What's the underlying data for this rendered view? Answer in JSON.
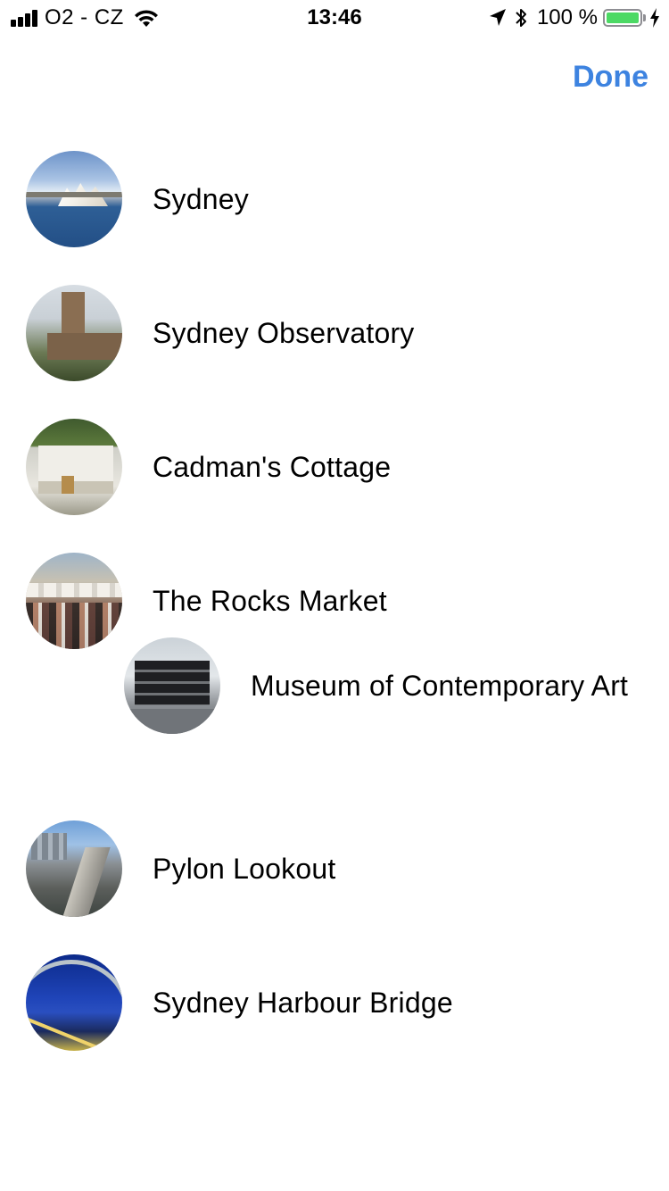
{
  "status_bar": {
    "carrier": "O2 - CZ",
    "time": "13:46",
    "battery_percent": "100 %",
    "battery_level": 1.0,
    "icons": [
      "signal-icon",
      "wifi-icon",
      "location-icon",
      "bluetooth-icon",
      "battery-icon",
      "charging-icon"
    ]
  },
  "nav": {
    "done_label": "Done",
    "accent_color": "#3d83e0"
  },
  "places": [
    {
      "name": "Sydney",
      "thumbnail": "sydney-opera-house-photo"
    },
    {
      "name": "Sydney Observatory",
      "thumbnail": "sydney-observatory-photo"
    },
    {
      "name": "Cadman's Cottage",
      "thumbnail": "cadmans-cottage-photo"
    },
    {
      "name": "The Rocks Market",
      "thumbnail": "the-rocks-market-photo"
    },
    {
      "name": "Museum of Contemporary Art",
      "thumbnail": "museum-of-contemporary-art-photo"
    },
    {
      "name": "Pylon Lookout",
      "thumbnail": "pylon-lookout-photo"
    },
    {
      "name": "Sydney Harbour Bridge",
      "thumbnail": "sydney-harbour-bridge-photo"
    }
  ]
}
